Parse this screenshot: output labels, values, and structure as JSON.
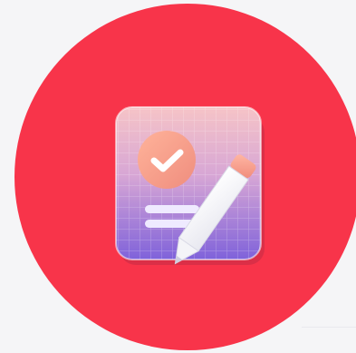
{
  "colors": {
    "background": "#f5f5f7",
    "circle": "#f8344a",
    "card_top": "#f3c1c6",
    "card_bottom": "#8f6ddc",
    "badge": "#f7a58a",
    "check": "#ffffff",
    "line": "#e7e2ff",
    "pencil_body": "#ffffff",
    "pencil_eraser": "#f6a391"
  },
  "icons": {
    "main": "document-check-pencil-icon",
    "check": "check-icon",
    "pencil": "pencil-icon"
  }
}
